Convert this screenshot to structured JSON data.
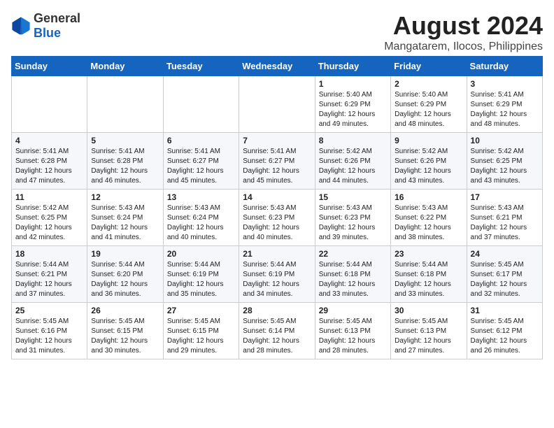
{
  "header": {
    "logo_general": "General",
    "logo_blue": "Blue",
    "month_year": "August 2024",
    "location": "Mangatarem, Ilocos, Philippines"
  },
  "days_of_week": [
    "Sunday",
    "Monday",
    "Tuesday",
    "Wednesday",
    "Thursday",
    "Friday",
    "Saturday"
  ],
  "weeks": [
    [
      {
        "day": "",
        "info": ""
      },
      {
        "day": "",
        "info": ""
      },
      {
        "day": "",
        "info": ""
      },
      {
        "day": "",
        "info": ""
      },
      {
        "day": "1",
        "info": "Sunrise: 5:40 AM\nSunset: 6:29 PM\nDaylight: 12 hours and 49 minutes."
      },
      {
        "day": "2",
        "info": "Sunrise: 5:40 AM\nSunset: 6:29 PM\nDaylight: 12 hours and 48 minutes."
      },
      {
        "day": "3",
        "info": "Sunrise: 5:41 AM\nSunset: 6:29 PM\nDaylight: 12 hours and 48 minutes."
      }
    ],
    [
      {
        "day": "4",
        "info": "Sunrise: 5:41 AM\nSunset: 6:28 PM\nDaylight: 12 hours and 47 minutes."
      },
      {
        "day": "5",
        "info": "Sunrise: 5:41 AM\nSunset: 6:28 PM\nDaylight: 12 hours and 46 minutes."
      },
      {
        "day": "6",
        "info": "Sunrise: 5:41 AM\nSunset: 6:27 PM\nDaylight: 12 hours and 45 minutes."
      },
      {
        "day": "7",
        "info": "Sunrise: 5:41 AM\nSunset: 6:27 PM\nDaylight: 12 hours and 45 minutes."
      },
      {
        "day": "8",
        "info": "Sunrise: 5:42 AM\nSunset: 6:26 PM\nDaylight: 12 hours and 44 minutes."
      },
      {
        "day": "9",
        "info": "Sunrise: 5:42 AM\nSunset: 6:26 PM\nDaylight: 12 hours and 43 minutes."
      },
      {
        "day": "10",
        "info": "Sunrise: 5:42 AM\nSunset: 6:25 PM\nDaylight: 12 hours and 43 minutes."
      }
    ],
    [
      {
        "day": "11",
        "info": "Sunrise: 5:42 AM\nSunset: 6:25 PM\nDaylight: 12 hours and 42 minutes."
      },
      {
        "day": "12",
        "info": "Sunrise: 5:43 AM\nSunset: 6:24 PM\nDaylight: 12 hours and 41 minutes."
      },
      {
        "day": "13",
        "info": "Sunrise: 5:43 AM\nSunset: 6:24 PM\nDaylight: 12 hours and 40 minutes."
      },
      {
        "day": "14",
        "info": "Sunrise: 5:43 AM\nSunset: 6:23 PM\nDaylight: 12 hours and 40 minutes."
      },
      {
        "day": "15",
        "info": "Sunrise: 5:43 AM\nSunset: 6:23 PM\nDaylight: 12 hours and 39 minutes."
      },
      {
        "day": "16",
        "info": "Sunrise: 5:43 AM\nSunset: 6:22 PM\nDaylight: 12 hours and 38 minutes."
      },
      {
        "day": "17",
        "info": "Sunrise: 5:43 AM\nSunset: 6:21 PM\nDaylight: 12 hours and 37 minutes."
      }
    ],
    [
      {
        "day": "18",
        "info": "Sunrise: 5:44 AM\nSunset: 6:21 PM\nDaylight: 12 hours and 37 minutes."
      },
      {
        "day": "19",
        "info": "Sunrise: 5:44 AM\nSunset: 6:20 PM\nDaylight: 12 hours and 36 minutes."
      },
      {
        "day": "20",
        "info": "Sunrise: 5:44 AM\nSunset: 6:19 PM\nDaylight: 12 hours and 35 minutes."
      },
      {
        "day": "21",
        "info": "Sunrise: 5:44 AM\nSunset: 6:19 PM\nDaylight: 12 hours and 34 minutes."
      },
      {
        "day": "22",
        "info": "Sunrise: 5:44 AM\nSunset: 6:18 PM\nDaylight: 12 hours and 33 minutes."
      },
      {
        "day": "23",
        "info": "Sunrise: 5:44 AM\nSunset: 6:18 PM\nDaylight: 12 hours and 33 minutes."
      },
      {
        "day": "24",
        "info": "Sunrise: 5:45 AM\nSunset: 6:17 PM\nDaylight: 12 hours and 32 minutes."
      }
    ],
    [
      {
        "day": "25",
        "info": "Sunrise: 5:45 AM\nSunset: 6:16 PM\nDaylight: 12 hours and 31 minutes."
      },
      {
        "day": "26",
        "info": "Sunrise: 5:45 AM\nSunset: 6:15 PM\nDaylight: 12 hours and 30 minutes."
      },
      {
        "day": "27",
        "info": "Sunrise: 5:45 AM\nSunset: 6:15 PM\nDaylight: 12 hours and 29 minutes."
      },
      {
        "day": "28",
        "info": "Sunrise: 5:45 AM\nSunset: 6:14 PM\nDaylight: 12 hours and 28 minutes."
      },
      {
        "day": "29",
        "info": "Sunrise: 5:45 AM\nSunset: 6:13 PM\nDaylight: 12 hours and 28 minutes."
      },
      {
        "day": "30",
        "info": "Sunrise: 5:45 AM\nSunset: 6:13 PM\nDaylight: 12 hours and 27 minutes."
      },
      {
        "day": "31",
        "info": "Sunrise: 5:45 AM\nSunset: 6:12 PM\nDaylight: 12 hours and 26 minutes."
      }
    ]
  ]
}
